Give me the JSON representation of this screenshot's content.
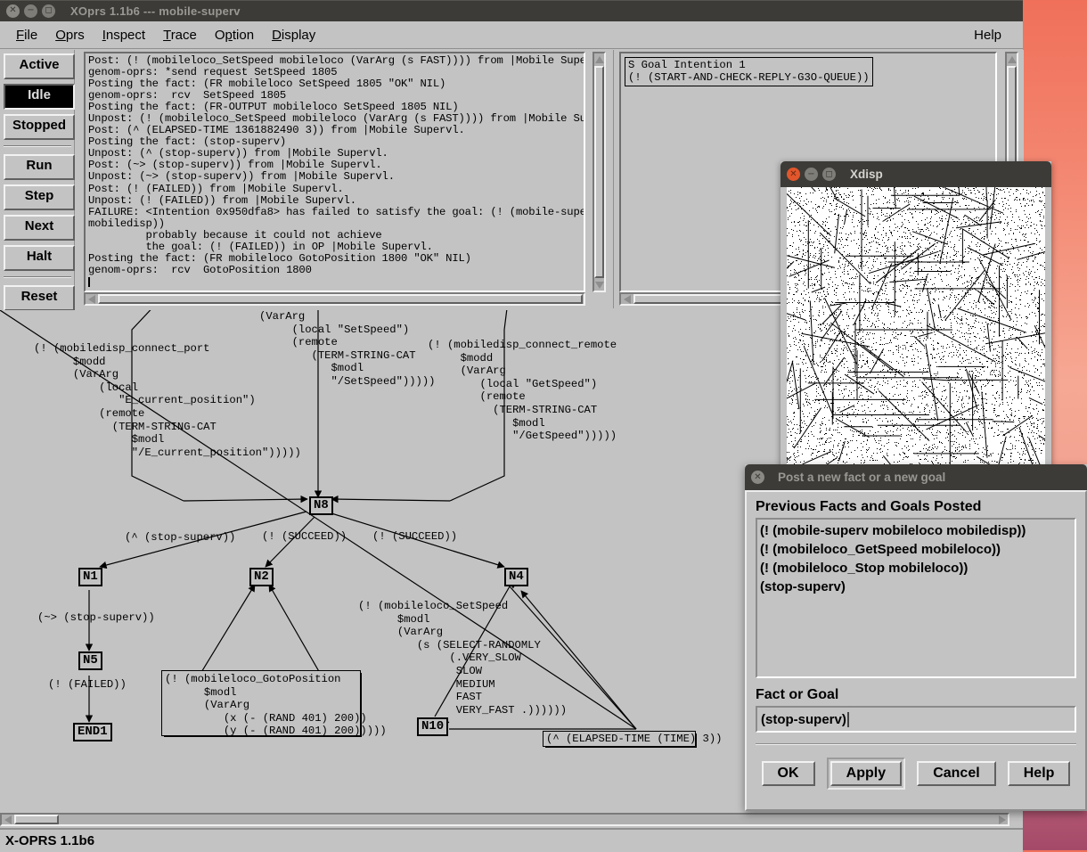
{
  "desktop": {
    "bg_top": "#f0705a",
    "bg_bottom": "#a44a68"
  },
  "main_window": {
    "title": "XOprs 1.1b6 --- mobile-superv",
    "titlebar_bg": "#3c3b37",
    "window_buttons": [
      "close",
      "minimize",
      "maximize"
    ],
    "menubar": [
      {
        "label": "File",
        "mnemonic": "F"
      },
      {
        "label": "Oprs",
        "mnemonic": "O"
      },
      {
        "label": "Inspect",
        "mnemonic": "I"
      },
      {
        "label": "Trace",
        "mnemonic": "T"
      },
      {
        "label": "Option",
        "mnemonic": "O"
      },
      {
        "label": "Display",
        "mnemonic": "D"
      }
    ],
    "menu_help": "Help",
    "statusbar": "X-OPRS 1.1b6"
  },
  "control_panel": {
    "state_buttons": [
      {
        "label": "Active",
        "active": false
      },
      {
        "label": "Idle",
        "active": true
      },
      {
        "label": "Stopped",
        "active": false
      }
    ],
    "action_buttons": [
      {
        "label": "Run"
      },
      {
        "label": "Step"
      },
      {
        "label": "Next"
      },
      {
        "label": "Halt"
      }
    ],
    "reset_button": {
      "label": "Reset"
    }
  },
  "log_panel": {
    "text": "Post: (! (mobileloco_SetSpeed mobileloco (VarArg (s FAST)))) from |Mobile Supervl.\ngenom-oprs: *send request SetSpeed 1805\nPosting the fact: (FR mobileloco SetSpeed 1805 \"OK\" NIL)\ngenom-oprs:  rcv  SetSpeed 1805\nPosting the fact: (FR-OUTPUT mobileloco SetSpeed 1805 NIL)\nUnpost: (! (mobileloco_SetSpeed mobileloco (VarArg (s FAST)))) from |Mobile Supervl.\nPost: (^ (ELAPSED-TIME 1361882490 3)) from |Mobile Supervl.\nPosting the fact: (stop-superv)\nUnpost: (^ (stop-superv)) from |Mobile Supervl.\nPost: (~> (stop-superv)) from |Mobile Supervl.\nUnpost: (~> (stop-superv)) from |Mobile Supervl.\nPost: (! (FAILED)) from |Mobile Supervl.\nUnpost: (! (FAILED)) from |Mobile Supervl.\nFAILURE: <Intention 0x950dfa8> has failed to satisfy the goal: (! (mobile-superv mobileloco\nmobiledisp))\n         probably because it could not achieve\n         the goal: (! (FAILED)) in OP |Mobile Supervl.\nPosting the fact: (FR mobileloco GotoPosition 1800 \"OK\" NIL)\ngenom-oprs:  rcv  GotoPosition 1800"
  },
  "goal_panel": {
    "intention": "S Goal Intention 1\n(! (START-AND-CHECK-REPLY-G3O-QUEUE))"
  },
  "graph": {
    "labels": {
      "connect_port": "(! (mobiledisp_connect_port\n      $modd\n      (VarArg\n          (local\n             \"E_current_position\")\n          (remote\n            (TERM-STRING-CAT\n               $modl\n               \"/E_current_position\")))))",
      "setspeed_top": "(VarArg\n     (local \"SetSpeed\")\n     (remote\n        (TERM-STRING-CAT\n           $modl\n           \"/SetSpeed\")))))",
      "connect_remote": "(! (mobiledisp_connect_remote\n     $modd\n     (VarArg\n        (local \"GetSpeed\")\n        (remote\n          (TERM-STRING-CAT\n             $modl\n             \"/GetSpeed\")))))",
      "edge_stop_superv_n1": "(^ (stop-superv))",
      "edge_succeed_n2": "(! (SUCCEED))",
      "edge_succeed_n4": "(! (SUCCEED))",
      "edge_stop_superv_n5": "(~> (stop-superv))",
      "edge_failed_end1": "(! (FAILED))",
      "gotoposition": "(! (mobileloco_GotoPosition\n      $modl\n      (VarArg\n         (x (- (RAND 401) 200))\n         (y (- (RAND 401) 200)))))",
      "setspeed_random": "(! (mobileloco_SetSpeed\n      $modl\n      (VarArg\n         (s (SELECT-RANDOMLY\n              (.VERY_SLOW\n               SLOW\n               MEDIUM\n               FAST\n               VERY_FAST .))))))",
      "elapsed_time": "(^ (ELAPSED-TIME (TIME) 3))"
    },
    "nodes": [
      {
        "id": "N8",
        "label": "N8"
      },
      {
        "id": "N1",
        "label": "N1"
      },
      {
        "id": "N2",
        "label": "N2"
      },
      {
        "id": "N4",
        "label": "N4"
      },
      {
        "id": "N5",
        "label": "N5"
      },
      {
        "id": "N10",
        "label": "N10"
      },
      {
        "id": "END1",
        "label": "END1"
      }
    ]
  },
  "xdisp_window": {
    "title": "Xdisp",
    "close_color": "#e2562c"
  },
  "post_dialog": {
    "title": "Post a new fact or a new goal",
    "list_label": "Previous Facts and Goals Posted",
    "list_items": [
      "(! (mobile-superv mobileloco mobiledisp))",
      "(! (mobileloco_GetSpeed mobileloco))",
      "(! (mobileloco_Stop mobileloco))",
      "(stop-superv)"
    ],
    "entry_label": "Fact or Goal",
    "entry_value": "(stop-superv)",
    "buttons": [
      {
        "label": "OK",
        "default": false
      },
      {
        "label": "Apply",
        "default": true
      },
      {
        "label": "Cancel",
        "default": false
      },
      {
        "label": "Help",
        "default": false
      }
    ]
  }
}
